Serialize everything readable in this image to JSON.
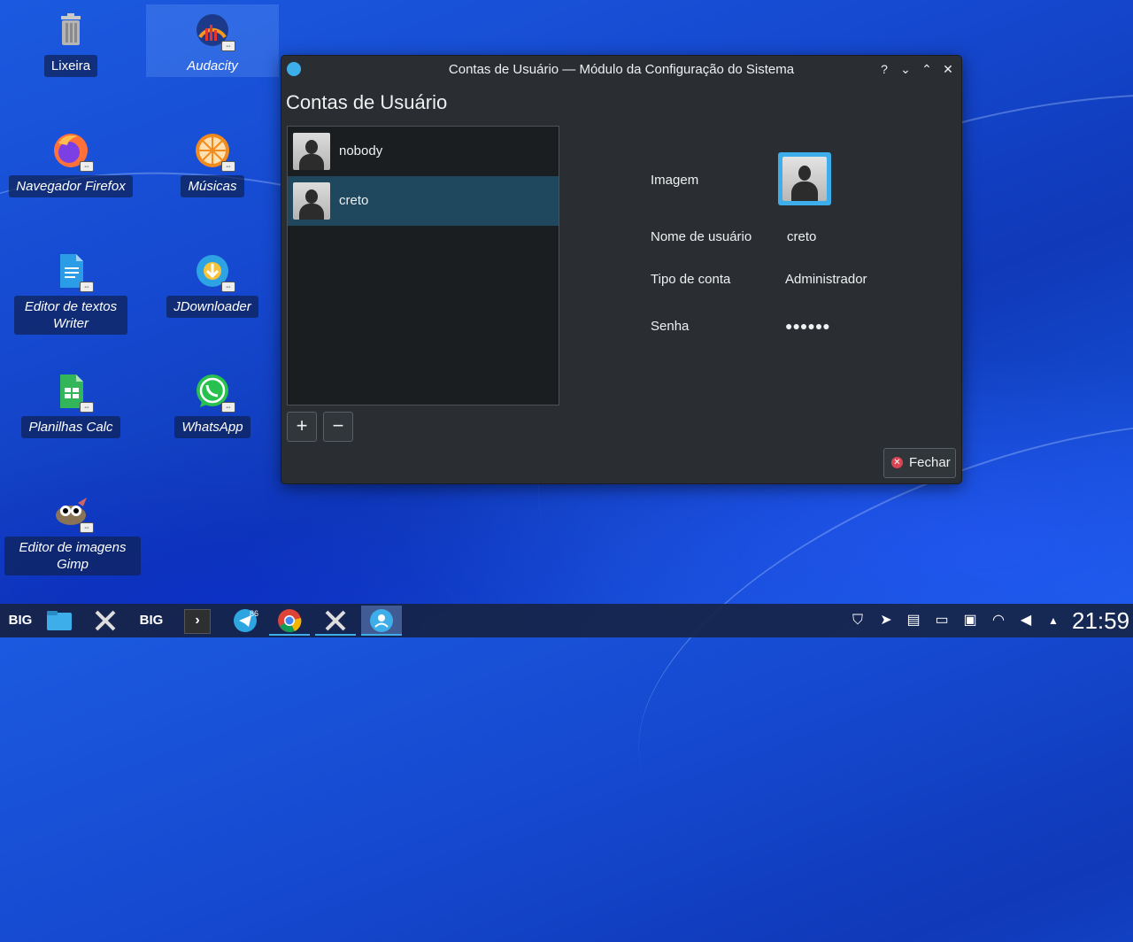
{
  "desktop": {
    "icons": [
      {
        "label": "Lixeira",
        "icon": "trash-icon"
      },
      {
        "label": "Audacity",
        "icon": "audacity-icon"
      },
      {
        "label": "Navegador Firefox",
        "icon": "firefox-icon"
      },
      {
        "label": "Músicas",
        "icon": "music-icon"
      },
      {
        "label": "Editor de textos Writer",
        "icon": "writer-icon"
      },
      {
        "label": "JDownloader",
        "icon": "jdownloader-icon"
      },
      {
        "label": "Planilhas Calc",
        "icon": "calc-icon"
      },
      {
        "label": "WhatsApp",
        "icon": "whatsapp-icon"
      },
      {
        "label": "Editor de imagens Gimp",
        "icon": "gimp-icon"
      }
    ]
  },
  "window": {
    "title": "Contas de Usuário — Módulo da Configuração do Sistema",
    "buttons": {
      "help": "?",
      "minimize": "⌄",
      "maximize": "⌃",
      "close": "✕"
    },
    "heading": "Contas de Usuário",
    "users": [
      {
        "name": "nobody",
        "selected": false
      },
      {
        "name": "creto",
        "selected": true
      }
    ],
    "add_label": "+",
    "remove_label": "−",
    "details": {
      "image_label": "Imagem",
      "username_label": "Nome de usuário",
      "username_value": "creto",
      "account_type_label": "Tipo de conta",
      "account_type_value": "Administrador",
      "password_label": "Senha",
      "password_value": "●●●●●●"
    },
    "close_button": "Fechar"
  },
  "taskbar": {
    "items": [
      {
        "icon": "app-launcher-icon",
        "label": "BIG"
      },
      {
        "icon": "file-manager-icon",
        "label": ""
      },
      {
        "icon": "big-tools-icon",
        "label": ""
      },
      {
        "icon": "big-store-icon",
        "label": "BIG"
      },
      {
        "icon": "terminal-icon",
        "label": "›"
      },
      {
        "icon": "telegram-icon",
        "label": "",
        "badge": "86"
      },
      {
        "icon": "chrome-icon",
        "label": ""
      },
      {
        "icon": "big-tools-icon",
        "label": ""
      },
      {
        "icon": "user-accounts-icon",
        "label": ""
      }
    ],
    "tray": [
      "shield-icon",
      "send-icon",
      "clipboard-icon",
      "battery-icon",
      "display-icon",
      "wifi-icon",
      "volume-icon",
      "expand-tray-icon"
    ],
    "clock": "21:59"
  },
  "colors": {
    "accent": "#3daee9",
    "window_bg": "#2a2e32",
    "selection": "#1f475e"
  }
}
